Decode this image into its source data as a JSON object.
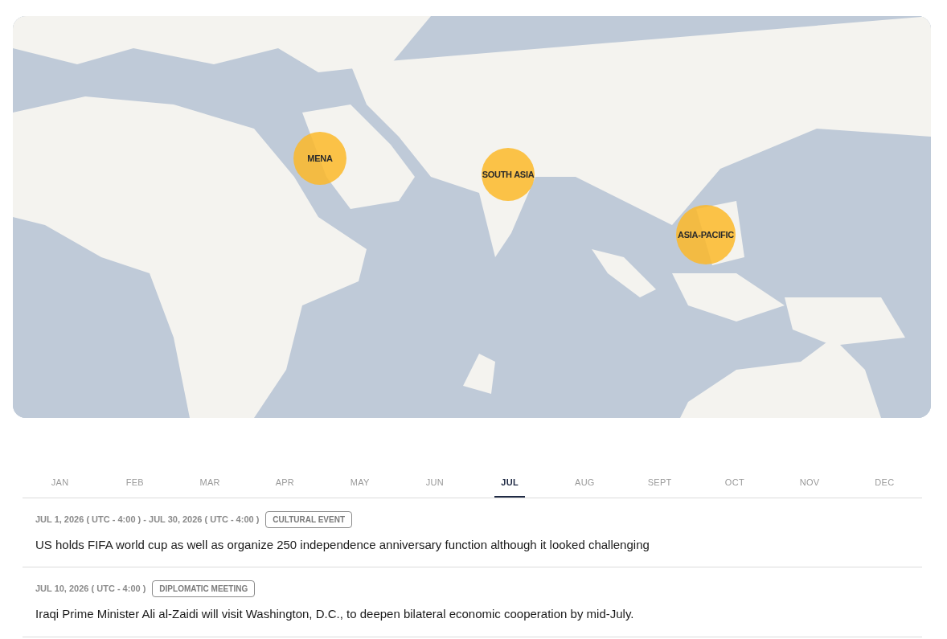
{
  "map": {
    "kind": "picture",
    "regions": [
      {
        "label": "MENA"
      },
      {
        "label": "SOUTH ASIA"
      },
      {
        "label": "ASIA-PACIFIC"
      }
    ]
  },
  "months": [
    {
      "label": "JAN",
      "selected": false
    },
    {
      "label": "FEB",
      "selected": false
    },
    {
      "label": "MAR",
      "selected": false
    },
    {
      "label": "APR",
      "selected": false
    },
    {
      "label": "MAY",
      "selected": false
    },
    {
      "label": "JUN",
      "selected": false
    },
    {
      "label": "JUL",
      "selected": true
    },
    {
      "label": "AUG",
      "selected": false
    },
    {
      "label": "SEPT",
      "selected": false
    },
    {
      "label": "OCT",
      "selected": false
    },
    {
      "label": "NOV",
      "selected": false
    },
    {
      "label": "DEC",
      "selected": false
    }
  ],
  "events": [
    {
      "date": "JUL 1, 2026 ( UTC - 4:00 ) - JUL 30, 2026 ( UTC - 4:00 )",
      "tag": "CULTURAL EVENT",
      "title": "US holds FIFA world cup as well as organize 250 independence anniversary function although it looked challenging"
    },
    {
      "date": "JUL 10, 2026 ( UTC - 4:00 )",
      "tag": "DIPLOMATIC MEETING",
      "title": "Iraqi Prime Minister Ali al-Zaidi will visit Washington, D.C., to deepen bilateral economic cooperation by mid-July."
    }
  ]
}
